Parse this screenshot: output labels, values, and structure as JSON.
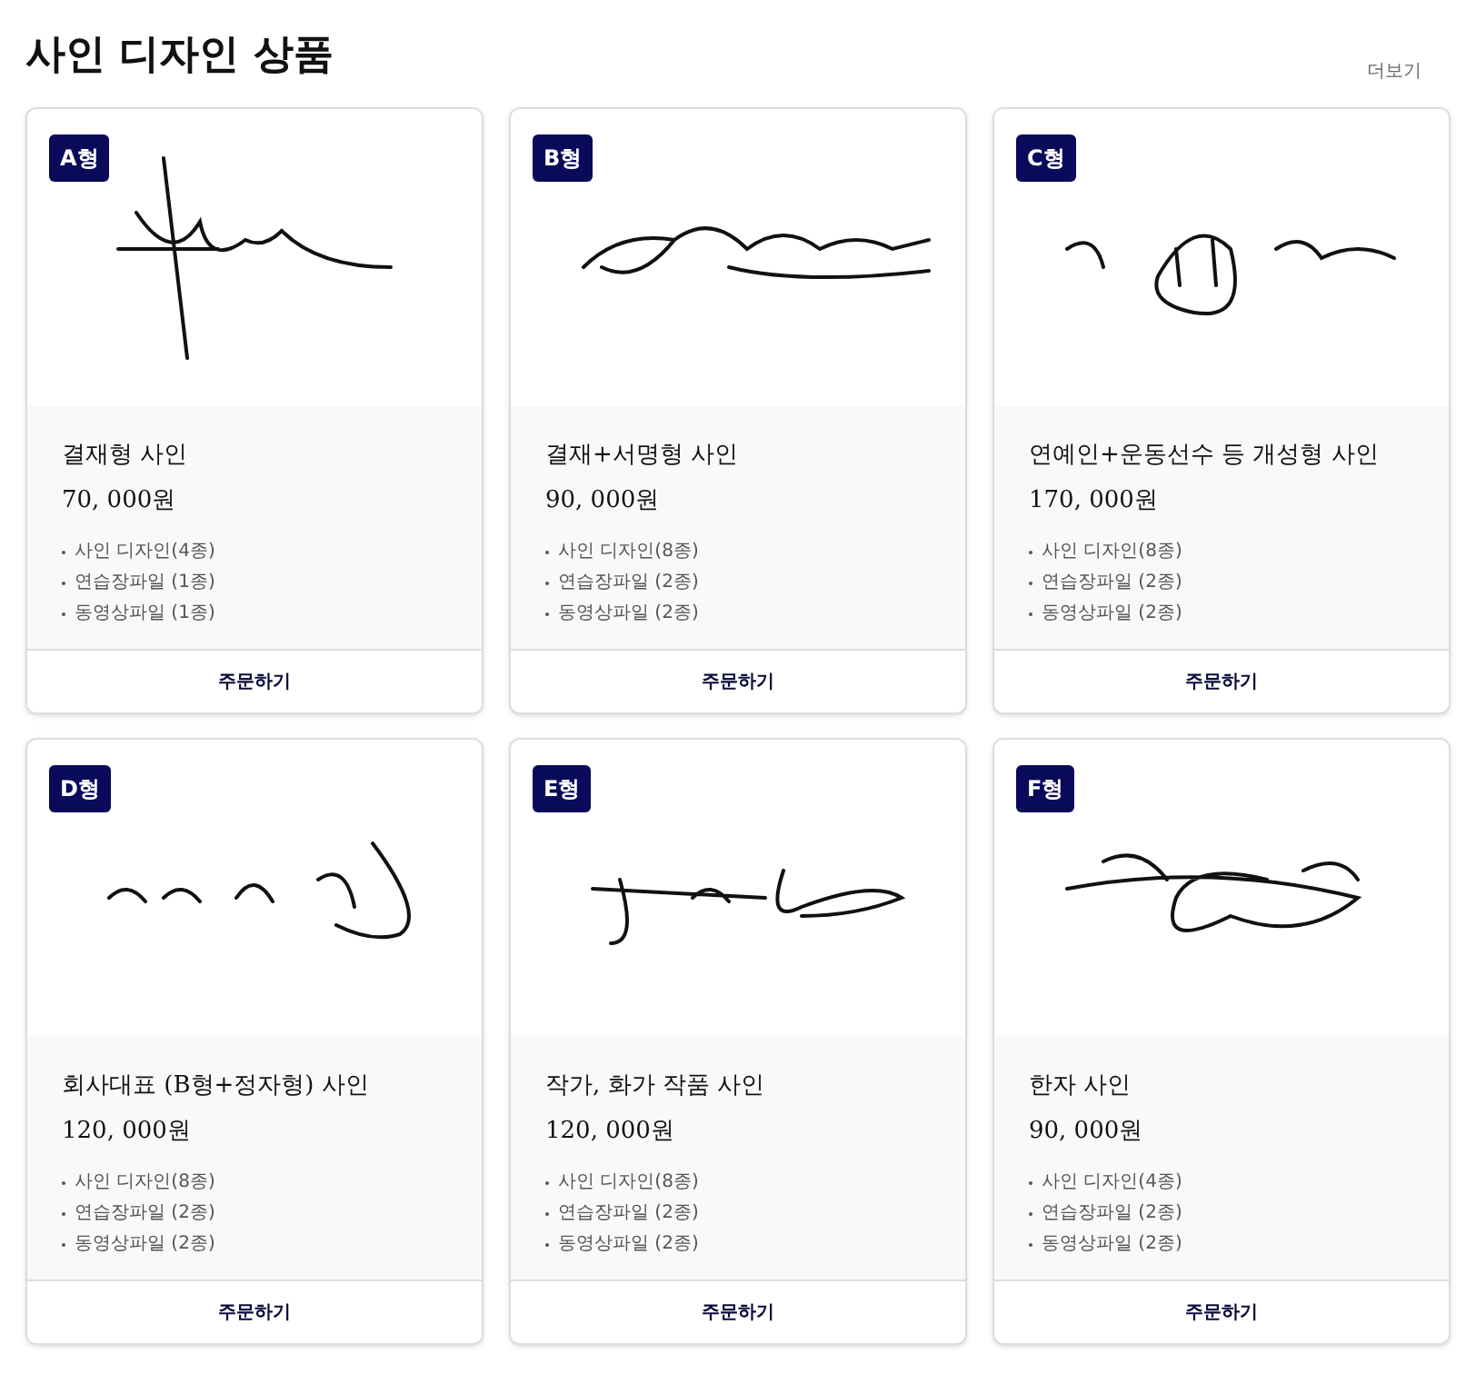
{
  "header": {
    "title": "사인 디자인 상품",
    "more_link": "더보기"
  },
  "products": [
    {
      "badge": "A형",
      "name": "결재형 사인",
      "price": "70, 000원",
      "features": [
        "사인 디자인(4종)",
        "연습장파일 (1종)",
        "동영상파일 (1종)"
      ],
      "button": "주문하기"
    },
    {
      "badge": "B형",
      "name": "결재+서명형 사인",
      "price": "90, 000원",
      "features": [
        "사인 디자인(8종)",
        "연습장파일 (2종)",
        "동영상파일 (2종)"
      ],
      "button": "주문하기"
    },
    {
      "badge": "C형",
      "name": "연예인+운동선수 등 개성형 사인",
      "price": "170, 000원",
      "features": [
        "사인 디자인(8종)",
        "연습장파일 (2종)",
        "동영상파일 (2종)"
      ],
      "button": "주문하기"
    },
    {
      "badge": "D형",
      "name": "회사대표 (B형+정자형) 사인",
      "price": "120, 000원",
      "features": [
        "사인 디자인(8종)",
        "연습장파일 (2종)",
        "동영상파일 (2종)"
      ],
      "button": "주문하기"
    },
    {
      "badge": "E형",
      "name": "작가, 화가 작품 사인",
      "price": "120, 000원",
      "features": [
        "사인 디자인(8종)",
        "연습장파일 (2종)",
        "동영상파일 (2종)"
      ],
      "button": "주문하기"
    },
    {
      "badge": "F형",
      "name": "한자 사인",
      "price": "90, 000원",
      "features": [
        "사인 디자인(4종)",
        "연습장파일 (2종)",
        "동영상파일 (2종)"
      ],
      "button": "주문하기"
    }
  ]
}
